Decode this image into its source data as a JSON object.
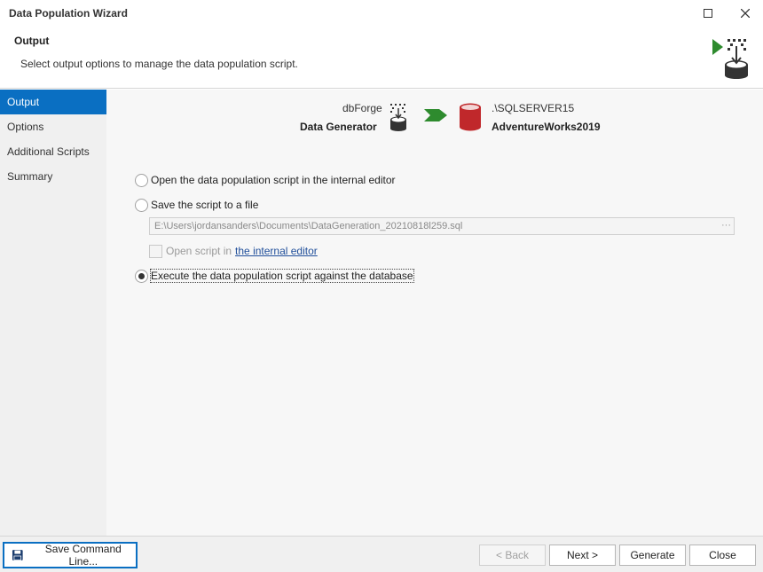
{
  "window": {
    "title": "Data Population Wizard"
  },
  "header": {
    "title": "Output",
    "description": "Select output options to manage the data population script."
  },
  "sidebar": {
    "items": [
      {
        "label": "Output",
        "active": true
      },
      {
        "label": "Options",
        "active": false
      },
      {
        "label": "Additional Scripts",
        "active": false
      },
      {
        "label": "Summary",
        "active": false
      }
    ]
  },
  "flow": {
    "source_name": "dbForge",
    "source_title": "Data Generator",
    "dest_server": ".\\SQLSERVER15",
    "dest_database": "AdventureWorks2019"
  },
  "options": {
    "open_in_editor": "Open the data population script in the internal editor",
    "save_to_file": "Save the script to a file",
    "file_path": "E:\\Users\\jordansanders\\Documents\\DataGeneration_20210818l259.sql",
    "browse_label": "···",
    "open_script_prefix": "Open script in",
    "open_script_link": "the internal editor",
    "execute": "Execute the data population script against the database",
    "selected": "execute"
  },
  "footer": {
    "save_command_line": "Save Command Line...",
    "back": "< Back",
    "next": "Next >",
    "generate": "Generate",
    "close": "Close"
  },
  "colors": {
    "accent": "#0a6fc2",
    "arrow_green": "#2e8b2e",
    "db_red": "#c0282b",
    "link": "#1f4e9a"
  },
  "icons": {
    "header": "data-generator-download-icon",
    "source": "data-generator-icon",
    "arrow": "green-chevron-arrow-icon",
    "dest": "database-cylinder-icon",
    "save": "floppy-disk-icon"
  }
}
